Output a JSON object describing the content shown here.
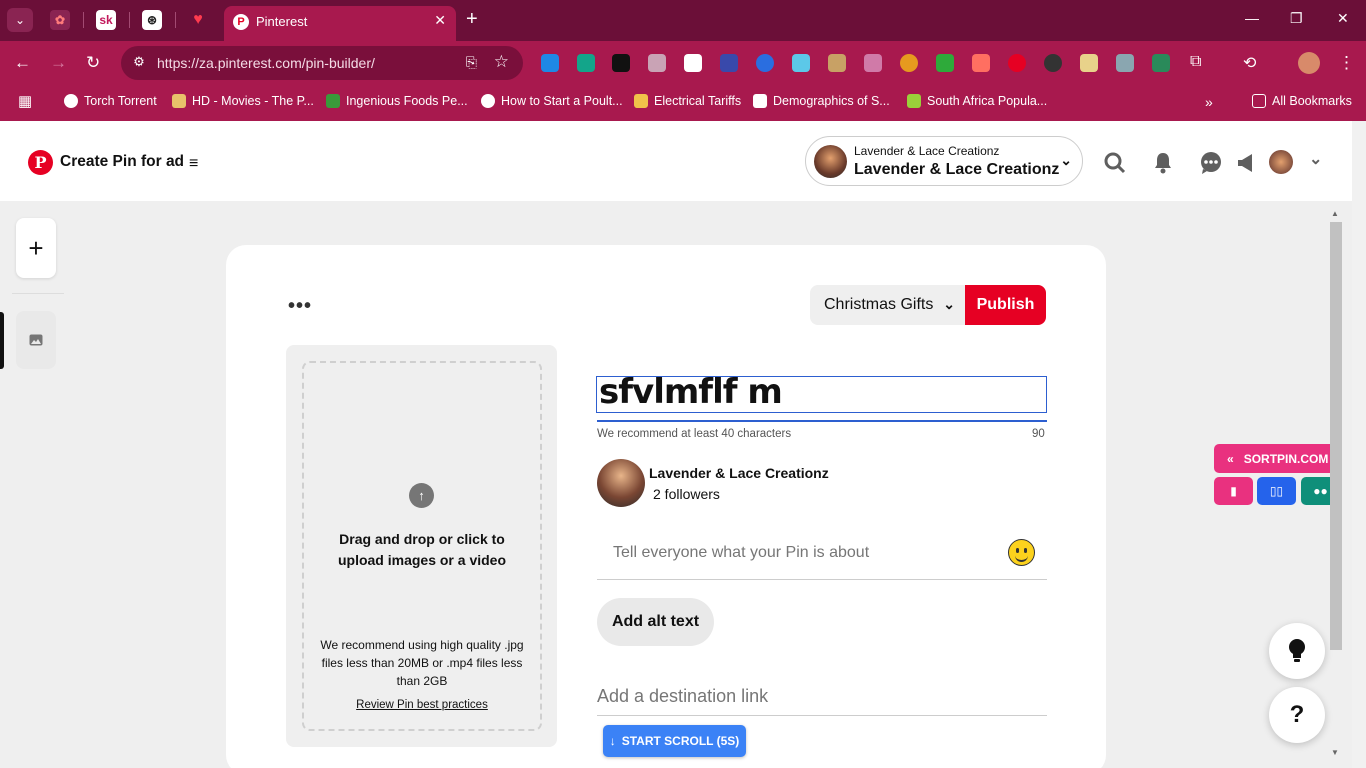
{
  "browser": {
    "tab_title": "Pinterest",
    "url": "https://za.pinterest.com/pin-builder/",
    "bookmarks": [
      {
        "label": "Torch Torrent"
      },
      {
        "label": "HD - Movies - The P..."
      },
      {
        "label": "Ingenious Foods Pe..."
      },
      {
        "label": "How to Start a Poult..."
      },
      {
        "label": "Electrical Tariffs"
      },
      {
        "label": "Demographics of S..."
      },
      {
        "label": "South Africa Popula..."
      }
    ],
    "all_bookmarks": "All Bookmarks",
    "colors": {
      "tabbar": "#6b0f38",
      "toolbar": "#a8194e"
    }
  },
  "header": {
    "title": "Create Pin for ad",
    "account_line1": "Lavender & Lace Creationz",
    "account_line2": "Lavender & Lace Creationz"
  },
  "editor": {
    "board": "Christmas Gifts",
    "publish": "Publish",
    "upload_main": "Drag and drop or click to upload images or a video",
    "upload_recommend": "We recommend using high quality .jpg files less than 20MB or .mp4 files less than 2GB",
    "upload_link": "Review Pin best practices",
    "title_value": "sfvlmflf m",
    "title_hint": "We recommend at least 40 characters",
    "char_count": "90",
    "user_name": "Lavender & Lace Creationz",
    "followers": "2 followers",
    "about_placeholder": "Tell everyone what your Pin is about",
    "alt_text": "Add alt text",
    "destination_placeholder": "Add a destination link"
  },
  "scroll_button": "START SCROLL (5S)",
  "sortpin": {
    "label": "SORTPIN.COM",
    "colors": [
      "#e9317f",
      "#2563eb",
      "#0f8f7a"
    ]
  },
  "fab": {
    "help": "?"
  }
}
